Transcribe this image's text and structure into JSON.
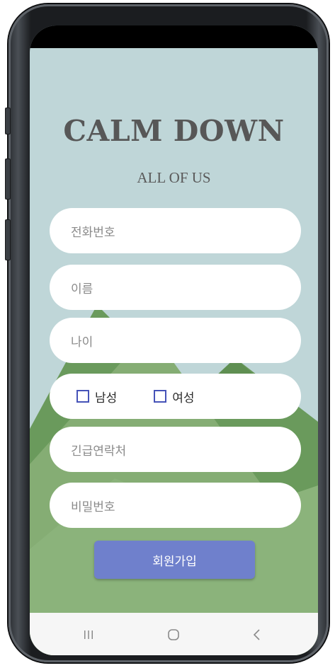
{
  "header": {
    "title": "CALM DOWN",
    "subtitle": "ALL OF US"
  },
  "form": {
    "phone_placeholder": "전화번호",
    "name_placeholder": "이름",
    "age_placeholder": "나이",
    "gender": {
      "male_label": "남성",
      "female_label": "여성",
      "male_checked": false,
      "female_checked": false
    },
    "emergency_contact_placeholder": "긴급연락처",
    "password_placeholder": "비밀번호",
    "signup_label": "회원가입"
  },
  "colors": {
    "sky": "#bfd6d8",
    "mountain_dark": "#6a9a5c",
    "mountain_light": "#85ad74",
    "button": "#6f80cc",
    "checkbox_border": "#4653b8",
    "title": "#575757"
  },
  "navbar": {
    "recent_icon": "recent-apps-icon",
    "home_icon": "home-icon",
    "back_icon": "back-icon"
  }
}
